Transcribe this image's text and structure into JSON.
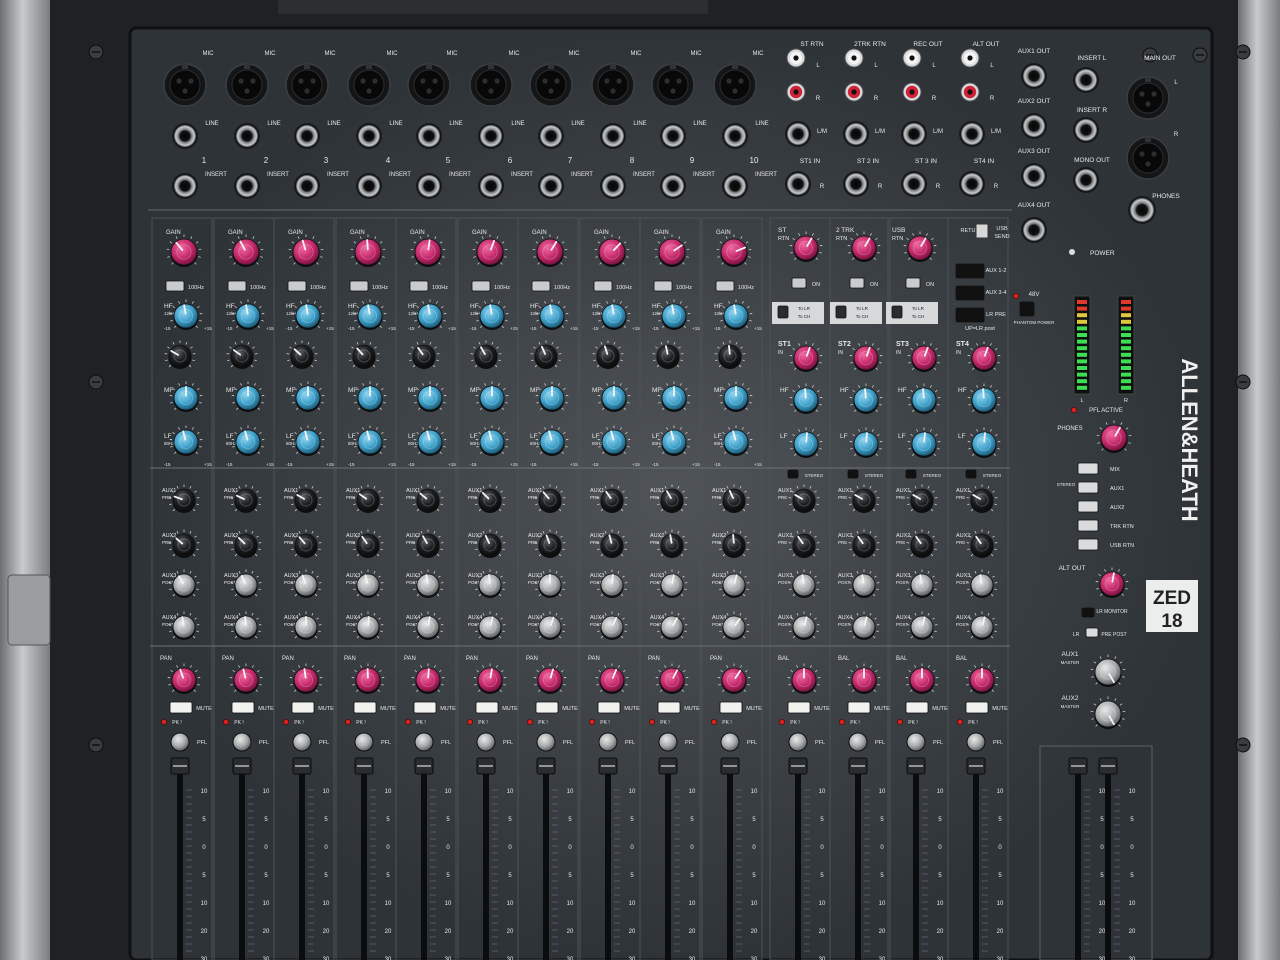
{
  "brand": {
    "name": "ALLEN&HEATH",
    "model_top": "ZED",
    "model_bottom": "18"
  },
  "top_io": {
    "mic_label": "MIC",
    "line_label": "LINE",
    "insert_label": "INSERT",
    "channel_numbers": [
      "1",
      "2",
      "3",
      "4",
      "5",
      "6",
      "7",
      "8",
      "9",
      "10"
    ],
    "stereo_groups": [
      {
        "top": "ST RTN",
        "bottom": "ST1 IN"
      },
      {
        "top": "2TRK RTN",
        "bottom": "ST 2 IN"
      },
      {
        "top": "REC OUT",
        "bottom": "ST 3 IN"
      },
      {
        "top": "ALT OUT",
        "bottom": "ST4 IN"
      }
    ],
    "lm_label": "L/M",
    "l_label": "L",
    "r_label": "R",
    "aux_outs": [
      "AUX1 OUT",
      "AUX2 OUT",
      "AUX3 OUT",
      "AUX4 OUT"
    ],
    "insert_l": "INSERT L",
    "insert_r": "INSERT R",
    "mono_out": "MONO OUT",
    "main_out": "MAIN OUT",
    "phones": "PHONES",
    "power": "POWER"
  },
  "mono_strip": {
    "gain": "GAIN",
    "hpf": "100Hz",
    "hf": "HF",
    "hf_freq": "12kHz",
    "mf": "MF",
    "lf": "LF",
    "lf_freq": "80Hz",
    "aux_labels": [
      "AUX1",
      "AUX2",
      "AUX3",
      "AUX4"
    ],
    "aux_sub": [
      "PRE",
      "PRE",
      "POST",
      "POST"
    ],
    "pan": "PAN",
    "mute": "MUTE",
    "pk": "PK !",
    "pfl": "PFL",
    "scale_min": "-15",
    "scale_max": "+15"
  },
  "stereo_returns": {
    "labels": [
      "ST\nRTN",
      "2 TRK\nRTN",
      "USB\nRTN"
    ],
    "on": "ON",
    "to_lr": "To LR",
    "to_ch": "To CH"
  },
  "stereo_strip": {
    "names": [
      "ST1",
      "ST2",
      "ST3",
      "ST4"
    ],
    "in_label": "IN",
    "stereo": "STEREO",
    "bal": "BAL"
  },
  "usb": {
    "return": "RETURN",
    "send": "USB\nSEND"
  },
  "routing": {
    "aux12": "AUX 1-2",
    "aux34": "AUX 3-4",
    "lr_pre": "LR PRE",
    "up_lr_post": "UP=LR post",
    "v48": "48V",
    "phantom": "PHANTOM POWER"
  },
  "master": {
    "pfl_active": "PFL ACTIVE",
    "phones": "PHONES",
    "select": [
      "MIX",
      "AUX1",
      "AUX2",
      "TRK RTN",
      "USB RTN"
    ],
    "stereo": "STEREO",
    "alt_out": "ALT OUT",
    "lr_monitor": "LR MONITOR",
    "pre_post": "PRE POST",
    "lr": "LR",
    "aux1_master": "AUX1",
    "aux2_master": "AUX2",
    "master_word": "MASTER",
    "meter_l": "L",
    "meter_r": "R"
  },
  "fader": {
    "scale": [
      "10",
      "5",
      "0",
      "5",
      "10",
      "20",
      "30"
    ]
  },
  "colors": {
    "panel": "#2e3338",
    "knob_pink": "#c4296b",
    "knob_blue": "#3ea0c9",
    "knob_grey": "#a8abac",
    "knob_black": "#1d1f22",
    "meter_green": "#3ddf52"
  }
}
